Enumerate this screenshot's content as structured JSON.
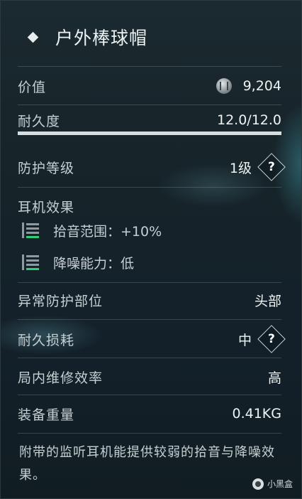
{
  "item": {
    "title": "户外棒球帽",
    "value": {
      "label": "价值",
      "amount": "9,204",
      "icon": "silver-coin-icon"
    },
    "durability": {
      "label": "耐久度",
      "value": "12.0/12.0",
      "fraction": 1.0
    },
    "protection": {
      "label": "防护等级",
      "value": "1级"
    },
    "headset": {
      "label": "耳机效果",
      "effects": [
        {
          "text": "拾音范围：+10%",
          "icon": "sound-level-icon"
        },
        {
          "text": "降噪能力：低",
          "icon": "sound-level-icon"
        }
      ]
    },
    "protected_area": {
      "label": "异常防护部位",
      "value": "头部"
    },
    "wear": {
      "label": "耐久损耗",
      "value": "中"
    },
    "repair": {
      "label": "局内维修效率",
      "value": "高"
    },
    "weight": {
      "label": "装备重量",
      "value": "0.41KG"
    },
    "description": "附带的监听耳机能提供较弱的拾音与降噪效果。",
    "help_symbol": "?"
  },
  "watermark": "小黑盒",
  "colors": {
    "accent_green": "#2fcf7a",
    "panel_bg": "#162329",
    "text": "#eef3f4"
  }
}
